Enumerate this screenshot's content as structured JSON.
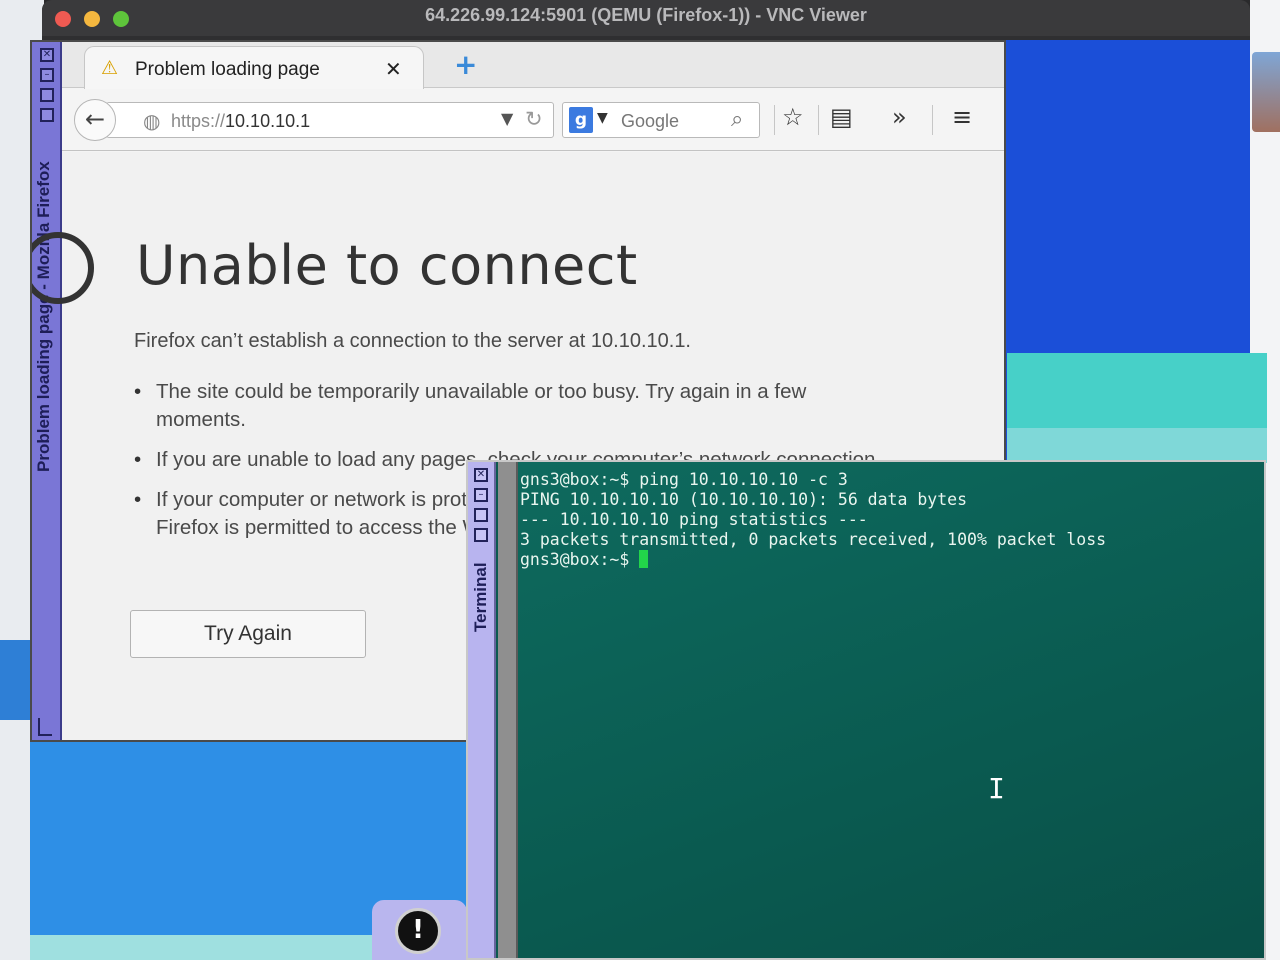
{
  "vnc": {
    "title": "64.226.99.124:5901 (QEMU (Firefox-1)) - VNC Viewer"
  },
  "firefox": {
    "window_title": "Problem loading page - Mozilla Firefox",
    "tab_label": "Problem loading page",
    "tab_icon": "warning-icon",
    "url_scheme": "https://",
    "url_host": "10.10.10.1",
    "search_engine": "Google",
    "error": {
      "title": "Unable to connect",
      "description": "Firefox can’t establish a connection to the server at 10.10.10.1.",
      "bullets": [
        "The site could be temporarily unavailable or too busy. Try again in a few moments.",
        "If you are unable to load any pages, check your computer’s network connection.",
        "If your computer or network is protected by a firewall or proxy, make sure that Firefox is permitted to access the Web."
      ],
      "button": "Try Again"
    }
  },
  "terminal": {
    "window_title": "Terminal",
    "lines": [
      "gns3@box:~$ ping 10.10.10.10 -c 3",
      "PING 10.10.10.10 (10.10.10.10): 56 data bytes",
      "",
      "--- 10.10.10.10 ping statistics ---",
      "3 packets transmitted, 0 packets received, 100% packet loss"
    ],
    "prompt": "gns3@box:~$ "
  },
  "colors": {
    "desktop_blue": "#1b4fd8",
    "terminal_bg": "#0b5a50",
    "wm_purple": "#7a76d6",
    "cursor_green": "#22d44a"
  }
}
